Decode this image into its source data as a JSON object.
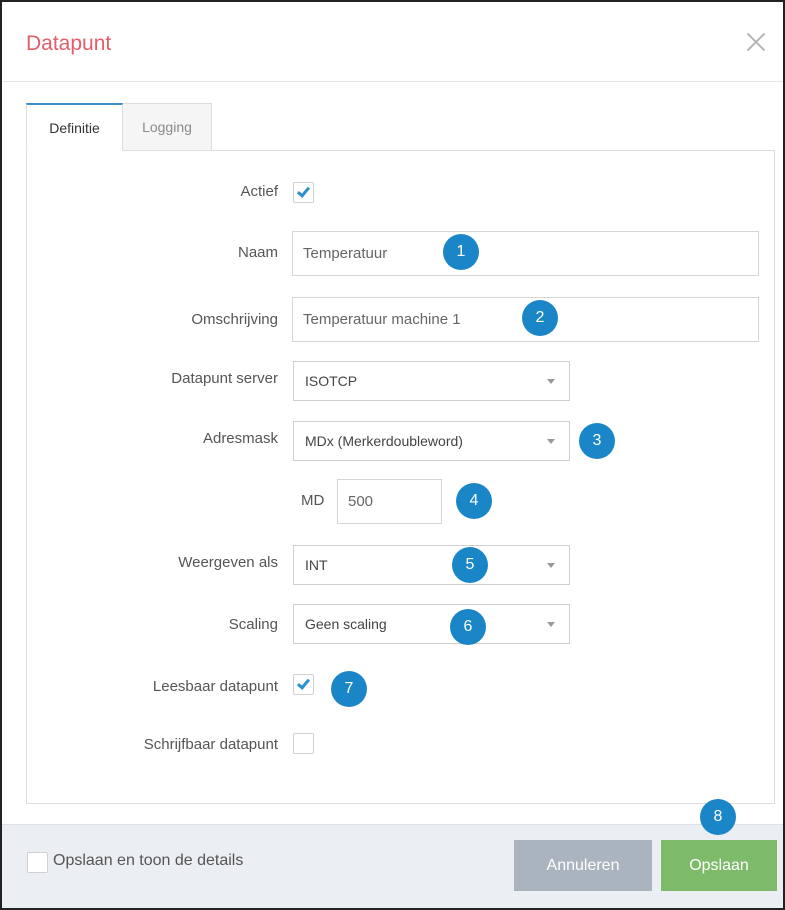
{
  "dialog": {
    "title": "Datapunt"
  },
  "tabs": [
    {
      "label": "Definitie",
      "active": true
    },
    {
      "label": "Logging",
      "active": false
    }
  ],
  "form": {
    "actief": {
      "label": "Actief",
      "checked": true
    },
    "naam": {
      "label": "Naam",
      "value": "Temperatuur"
    },
    "omschrijving": {
      "label": "Omschrijving",
      "value": "Temperatuur machine 1"
    },
    "datapunt_server": {
      "label": "Datapunt server",
      "selected": "ISOTCP"
    },
    "adresmask": {
      "label": "Adresmask",
      "selected": "MDx (Merkerdoubleword)"
    },
    "md": {
      "prefix": "MD",
      "value": "500"
    },
    "weergeven_als": {
      "label": "Weergeven als",
      "selected": "INT"
    },
    "scaling": {
      "label": "Scaling",
      "selected": "Geen scaling"
    },
    "leesbaar": {
      "label": "Leesbaar datapunt",
      "checked": true
    },
    "schrijfbaar": {
      "label": "Schrijfbaar datapunt",
      "checked": false
    }
  },
  "badges": [
    "1",
    "2",
    "3",
    "4",
    "5",
    "6",
    "7",
    "8"
  ],
  "footer": {
    "details_label": "Opslaan en toon de details",
    "details_checked": false,
    "cancel_label": "Annuleren",
    "save_label": "Opslaan"
  },
  "colors": {
    "title": "#e35d6a",
    "accent": "#1a86c8",
    "cancel_button": "#a9b4be",
    "save_button": "#7dba6a"
  }
}
